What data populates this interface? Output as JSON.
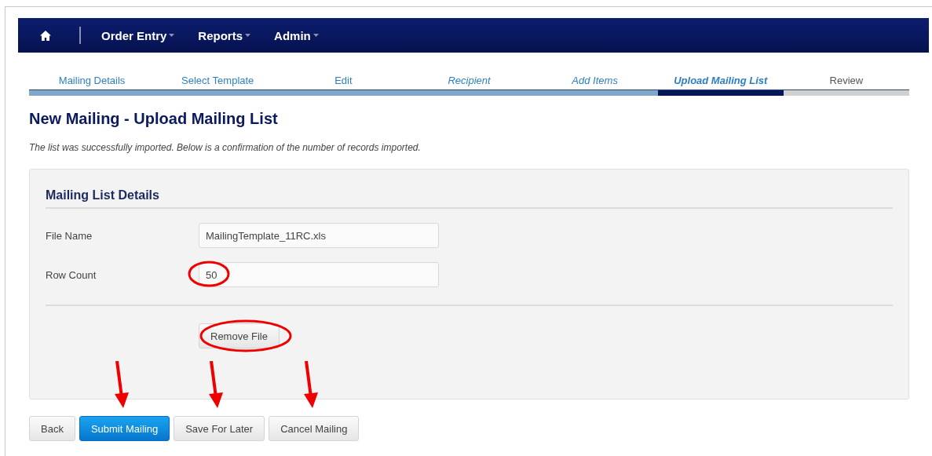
{
  "nav": {
    "items": [
      {
        "label": "Order Entry"
      },
      {
        "label": "Reports"
      },
      {
        "label": "Admin"
      }
    ]
  },
  "steps": [
    {
      "label": "Mailing Details",
      "completed": true,
      "selected": false,
      "italic": false
    },
    {
      "label": "Select Template",
      "completed": true,
      "selected": false,
      "italic": false
    },
    {
      "label": "Edit",
      "completed": true,
      "selected": false,
      "italic": false
    },
    {
      "label": "Recipient",
      "completed": true,
      "selected": false,
      "italic": true
    },
    {
      "label": "Add Items",
      "completed": true,
      "selected": false,
      "italic": true
    },
    {
      "label": "Upload Mailing List",
      "completed": false,
      "selected": true,
      "italic": true
    },
    {
      "label": "Review",
      "completed": false,
      "selected": false,
      "italic": false
    }
  ],
  "title": "New Mailing - Upload Mailing List",
  "message": "The list was successfully imported. Below is a confirmation of the number of records imported.",
  "panel": {
    "heading": "Mailing List Details",
    "fields": [
      {
        "label": "File Name",
        "value": "MailingTemplate_11RC.xls",
        "circled": false
      },
      {
        "label": "Row Count",
        "value": "50",
        "circled": true
      }
    ],
    "remove_button": {
      "label": "Remove File",
      "circled": true
    }
  },
  "buttons": [
    {
      "label": "Back",
      "kind": "default",
      "arrow": false
    },
    {
      "label": "Submit Mailing",
      "kind": "primary",
      "arrow": true
    },
    {
      "label": "Save For Later",
      "kind": "default",
      "arrow": true
    },
    {
      "label": "Cancel Mailing",
      "kind": "default",
      "arrow": true
    }
  ]
}
